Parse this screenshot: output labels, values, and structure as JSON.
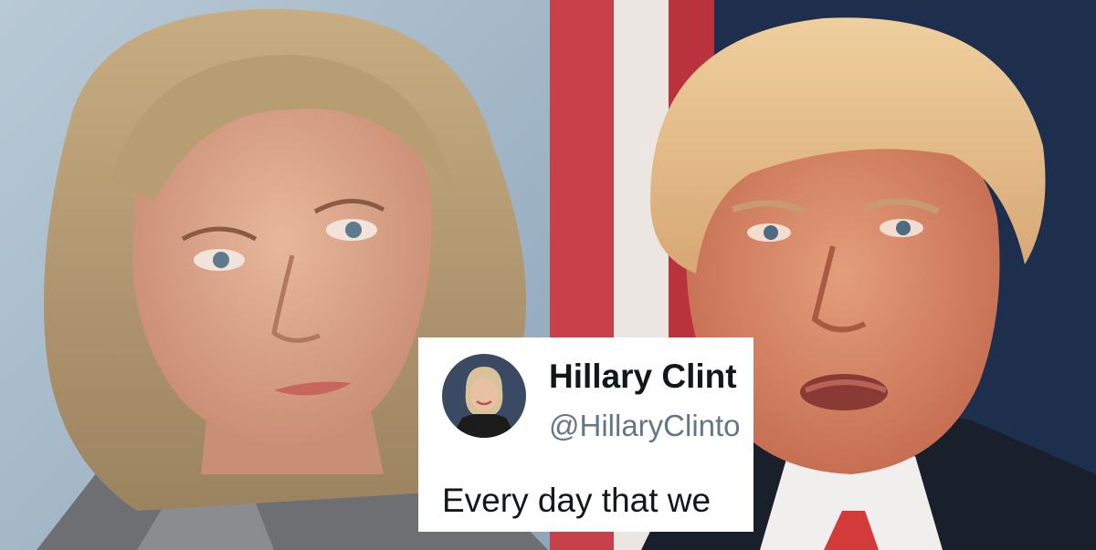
{
  "tweet": {
    "name": "Hillary Clint",
    "handle": "@HillaryClinto",
    "text": "Every day that we"
  },
  "colors": {
    "card_background": "#ffffff",
    "name_color": "#14171a",
    "handle_color": "#657786",
    "left_background": "#a9bccb",
    "right_background": "#1e2f4e"
  }
}
